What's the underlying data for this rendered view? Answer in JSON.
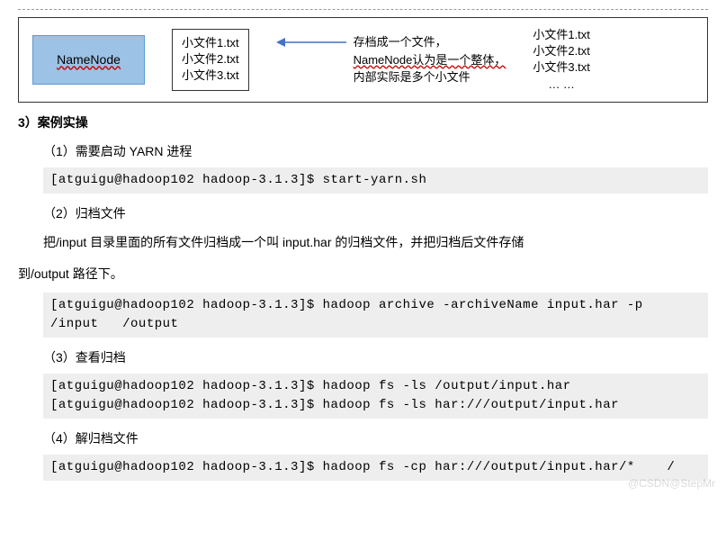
{
  "diagram": {
    "namenode": "NameNode",
    "smallfiles_box": [
      "小文件1.txt",
      "小文件2.txt",
      "小文件3.txt"
    ],
    "archive_lines": [
      "存档成一个文件，",
      "NameNode认为是一个整体，",
      "内部实际是多个小文件"
    ],
    "rightlist": [
      "小文件1.txt",
      "小文件2.txt",
      "小文件3.txt",
      "… …"
    ]
  },
  "heading": "3）案例实操",
  "steps": {
    "s1": "（1）需要启动 YARN 进程",
    "code1": "[atguigu@hadoop102 hadoop-3.1.3]$ start-yarn.sh",
    "s2": "（2）归档文件",
    "para2a": "把/input 目录里面的所有文件归档成一个叫 input.har 的归档文件，并把归档后文件存储",
    "para2b": "到/output 路径下。",
    "code2": "[atguigu@hadoop102 hadoop-3.1.3]$ hadoop archive -archiveName input.har -p  /input   /output",
    "s3": "（3）查看归档",
    "code3": "[atguigu@hadoop102 hadoop-3.1.3]$ hadoop fs -ls /output/input.har\n[atguigu@hadoop102 hadoop-3.1.3]$ hadoop fs -ls har:///output/input.har",
    "s4": "（4）解归档文件",
    "code4": "[atguigu@hadoop102 hadoop-3.1.3]$ hadoop fs -cp har:///output/input.har/*    /"
  },
  "watermark": "@CSDN@StepMr"
}
